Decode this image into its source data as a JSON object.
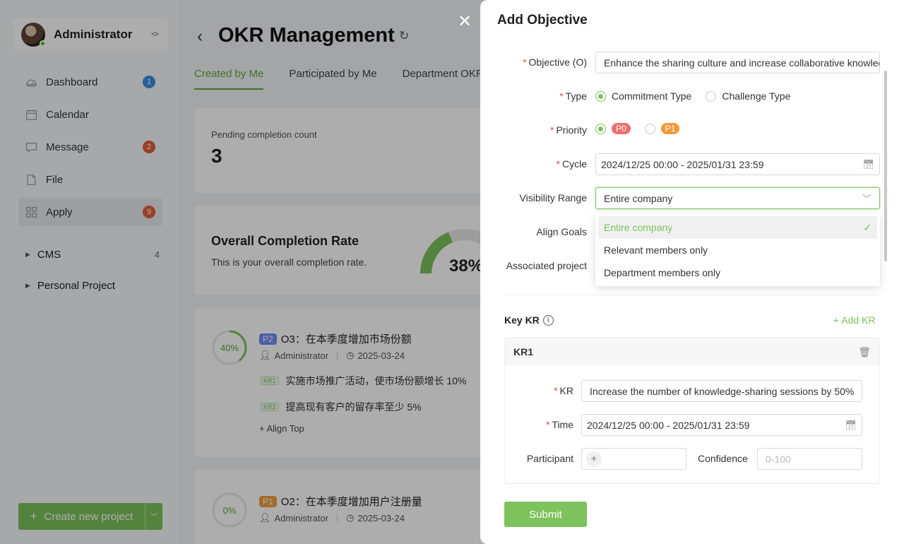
{
  "user": {
    "name": "Administrator"
  },
  "nav": [
    {
      "label": "Dashboard",
      "icon": "dashboard-icon",
      "badge": "1",
      "badge_color": "#3a8ee6"
    },
    {
      "label": "Calendar",
      "icon": "calendar-icon",
      "badge": null
    },
    {
      "label": "Message",
      "icon": "message-icon",
      "badge": "2",
      "badge_color": "#e35d3b"
    },
    {
      "label": "File",
      "icon": "file-icon",
      "badge": null
    },
    {
      "label": "Apply",
      "icon": "apps-icon",
      "badge": "9",
      "badge_color": "#e35d3b",
      "active": true
    }
  ],
  "tree": [
    {
      "label": "CMS",
      "count": "4"
    },
    {
      "label": "Personal Project",
      "count": ""
    }
  ],
  "create_button": "Create new project",
  "main": {
    "title": "OKR Management",
    "tabs": [
      "Created by Me",
      "Participated by Me",
      "Department OKR"
    ],
    "pending": {
      "label": "Pending completion count",
      "value": "3"
    },
    "completion": {
      "title": "Overall Completion Rate",
      "desc": "This is your overall completion rate.",
      "value": "38%",
      "percent": 38
    },
    "okrs": [
      {
        "progress": "40%",
        "percent": 40,
        "priority": "P2",
        "title": "O3：在本季度增加市场份额",
        "owner": "Administrator",
        "date": "2025-03-24",
        "krs": [
          {
            "tag": "KR1",
            "text": "实施市场推广活动，使市场份额增长 10%"
          },
          {
            "tag": "KR2",
            "text": "提高现有客户的留存率至少 5%"
          }
        ],
        "align": "+ Align Top"
      },
      {
        "progress": "0%",
        "percent": 0,
        "priority": "P1",
        "title": "O2：在本季度增加用户注册量",
        "owner": "Administrator",
        "date": "2025-03-24"
      }
    ]
  },
  "drawer": {
    "title": "Add Objective",
    "objective": {
      "label": "Objective (O)",
      "value": "Enhance the sharing culture and increase collaborative knowledge"
    },
    "type": {
      "label": "Type",
      "options": [
        "Commitment Type",
        "Challenge Type"
      ],
      "selected": "Commitment Type"
    },
    "priority": {
      "label": "Priority",
      "options": [
        "P0",
        "P1"
      ],
      "selected": "P0"
    },
    "cycle": {
      "label": "Cycle",
      "value": "2024/12/25 00:00 - 2025/01/31 23:59"
    },
    "visibility": {
      "label": "Visibility Range",
      "value": "Entire company",
      "options": [
        "Entire company",
        "Relevant members only",
        "Department members only"
      ]
    },
    "align_goals": {
      "label": "Align Goals"
    },
    "associated": {
      "label": "Associated project"
    },
    "kr_section": {
      "title": "Key KR",
      "add": "Add KR"
    },
    "kr1": {
      "title": "KR1",
      "kr_label": "KR",
      "kr_value": "Increase the number of knowledge-sharing sessions by 50%",
      "time_label": "Time",
      "time_value": "2024/12/25 00:00 - 2025/01/31 23:59",
      "participant_label": "Participant",
      "confidence_label": "Confidence",
      "confidence_placeholder": "0-100"
    },
    "submit": "Submit"
  },
  "colors": {
    "accent": "#7dc25c",
    "required": "#e34d4d",
    "p0": "#ee6f6f",
    "p1": "#f3983a",
    "p2": "#6d8cf5"
  }
}
